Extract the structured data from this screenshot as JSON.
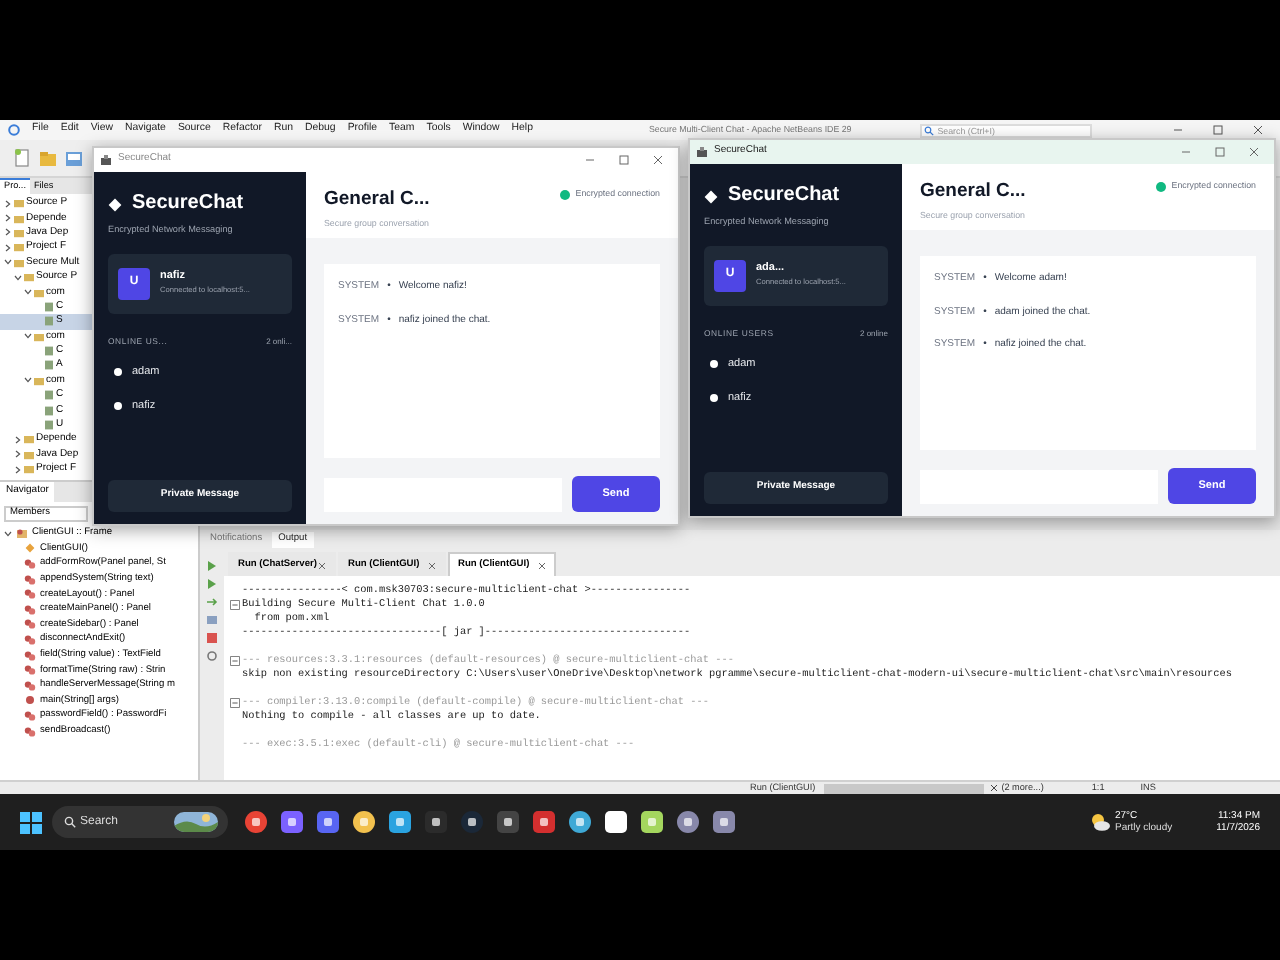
{
  "ide": {
    "title": "Secure Multi-Client Chat - Apache NetBeans IDE 29",
    "menu": [
      "File",
      "Edit",
      "View",
      "Navigate",
      "Source",
      "Refactor",
      "Run",
      "Debug",
      "Profile",
      "Team",
      "Tools",
      "Window",
      "Help"
    ],
    "search": {
      "placeholder": "Search (Ctrl+I)"
    },
    "project_tabs": [
      {
        "label": "Pro...",
        "selected": true
      },
      {
        "label": "Files",
        "selected": false
      }
    ],
    "project_tree": [
      {
        "label": "Source P",
        "expanded": false,
        "selected": false
      },
      {
        "label": "Depende",
        "expanded": false,
        "selected": false
      },
      {
        "label": "Java Dep",
        "expanded": false,
        "selected": false
      },
      {
        "label": "Project F",
        "expanded": false,
        "selected": false
      },
      {
        "label": "Secure Mult",
        "expanded": true,
        "selected": false,
        "children": [
          {
            "label": "Source P",
            "expanded": true,
            "selected": false,
            "children": [
              {
                "label": "com",
                "expanded": true,
                "selected": false,
                "children": [
                  {
                    "label": "C",
                    "selected": false
                  },
                  {
                    "label": "S",
                    "selected": true
                  }
                ]
              },
              {
                "label": "com",
                "expanded": true,
                "selected": false,
                "children": [
                  {
                    "label": "C",
                    "selected": false
                  },
                  {
                    "label": "A",
                    "selected": false
                  }
                ]
              },
              {
                "label": "com",
                "expanded": true,
                "selected": false,
                "children": [
                  {
                    "label": "C",
                    "selected": false
                  },
                  {
                    "label": "C",
                    "selected": false
                  },
                  {
                    "label": "U",
                    "selected": false
                  }
                ]
              }
            ]
          },
          {
            "label": "Depende",
            "expanded": false,
            "selected": false
          },
          {
            "label": "Java Dep",
            "expanded": false,
            "selected": false
          },
          {
            "label": "Project F",
            "expanded": false,
            "selected": false
          }
        ]
      }
    ],
    "navigator": {
      "tab": "Navigator",
      "filter": "Members",
      "root": {
        "label": "ClientGUI :: Frame",
        "kind": "class",
        "expanded": true,
        "children": [
          {
            "label": "ClientGUI()",
            "kind": "constructor"
          },
          {
            "label": "addFormRow(Panel panel, St",
            "kind": "method"
          },
          {
            "label": "appendSystem(String text)",
            "kind": "method"
          },
          {
            "label": "createLayout() : Panel",
            "kind": "method"
          },
          {
            "label": "createMainPanel() : Panel",
            "kind": "method"
          },
          {
            "label": "createSidebar() : Panel",
            "kind": "method"
          },
          {
            "label": "disconnectAndExit()",
            "kind": "method"
          },
          {
            "label": "field(String value) : TextField",
            "kind": "method"
          },
          {
            "label": "formatTime(String raw) : Strin",
            "kind": "method"
          },
          {
            "label": "handleServerMessage(String m",
            "kind": "method"
          },
          {
            "label": "main(String[] args)",
            "kind": "static"
          },
          {
            "label": "passwordField() : PasswordFi",
            "kind": "method"
          },
          {
            "label": "sendBroadcast()",
            "kind": "method"
          }
        ]
      }
    },
    "output": {
      "tabs": [
        {
          "label": "Notifications",
          "selected": false
        },
        {
          "label": "Output",
          "selected": true
        }
      ],
      "run_tabs": [
        {
          "label": "Run (ChatServer)",
          "selected": false
        },
        {
          "label": "Run (ClientGUI)",
          "selected": false
        },
        {
          "label": "Run (ClientGUI)",
          "selected": true
        }
      ],
      "blocks": [
        [
          {
            "text": "----------------< com.msk30703:secure-multiclient-chat >----------------",
            "kind": "plain"
          },
          {
            "text": "Building Secure Multi-Client Chat 1.0.0",
            "kind": "plain",
            "expanded": true
          },
          {
            "text": "  from pom.xml",
            "kind": "plain"
          },
          {
            "text": "--------------------------------[ jar ]---------------------------------",
            "kind": "plain"
          }
        ],
        [
          {
            "text": "--- resources:3.3.1:resources (default-resources) @ secure-multiclient-chat ---",
            "kind": "dim",
            "expanded": true
          },
          {
            "text": "skip non existing resourceDirectory C:\\Users\\user\\OneDrive\\Desktop\\network pgramme\\secure-multiclient-chat-modern-ui\\secure-multiclient-chat\\src\\main\\resources",
            "kind": "plain"
          }
        ],
        [
          {
            "text": "--- compiler:3.13.0:compile (default-compile) @ secure-multiclient-chat ---",
            "kind": "dim",
            "expanded": true
          },
          {
            "text": "Nothing to compile - all classes are up to date.",
            "kind": "plain"
          }
        ],
        [
          {
            "text": "--- exec:3.5.1:exec (default-cli) @ secure-multiclient-chat ---",
            "kind": "dim"
          }
        ]
      ]
    },
    "status_bar": {
      "task": "Run (ClientGUI)",
      "progress": {
        "level": 1
      },
      "more": "(2 more...)",
      "position": "1:1",
      "mode": "INS"
    }
  },
  "chat_windows": [
    {
      "active": false,
      "title": "SecureChat",
      "brand": "SecureChat",
      "tagline": "Encrypted Network Messaging",
      "user": {
        "avatar": "U",
        "name": "nafiz",
        "status": "Connected to localhost:5..."
      },
      "online": {
        "label": "ONLINE US...",
        "count": "2 onli...",
        "users": [
          {
            "name": "adam"
          },
          {
            "name": "nafiz"
          }
        ]
      },
      "private_button": "Private Message",
      "channel": {
        "title": "General C...",
        "subtitle": "Secure group conversation",
        "security": "Encrypted connection"
      },
      "messages": [
        {
          "sender": "SYSTEM",
          "separator": "•",
          "text": "Welcome nafiz!"
        },
        {
          "sender": "SYSTEM",
          "separator": "•",
          "text": "nafiz joined the chat."
        }
      ],
      "send_button": "Send"
    },
    {
      "active": true,
      "title": "SecureChat",
      "brand": "SecureChat",
      "tagline": "Encrypted Network Messaging",
      "user": {
        "avatar": "U",
        "name": "ada...",
        "status": "Connected to localhost:5..."
      },
      "online": {
        "label": "ONLINE USERS",
        "count": "2 online",
        "users": [
          {
            "name": "adam"
          },
          {
            "name": "nafiz"
          }
        ]
      },
      "private_button": "Private Message",
      "channel": {
        "title": "General C...",
        "subtitle": "Secure group conversation",
        "security": "Encrypted connection"
      },
      "messages": [
        {
          "sender": "SYSTEM",
          "separator": "•",
          "text": "Welcome adam!"
        },
        {
          "sender": "SYSTEM",
          "separator": "•",
          "text": "adam joined the chat."
        },
        {
          "sender": "SYSTEM",
          "separator": "•",
          "text": "nafiz joined the chat."
        }
      ],
      "send_button": "Send"
    }
  ],
  "taskbar": {
    "search": {
      "placeholder": "Search"
    },
    "weather": {
      "temperature": "27°C",
      "condition": "Partly cloudy"
    },
    "time": "11:34 PM",
    "date": "11/7/2026"
  }
}
